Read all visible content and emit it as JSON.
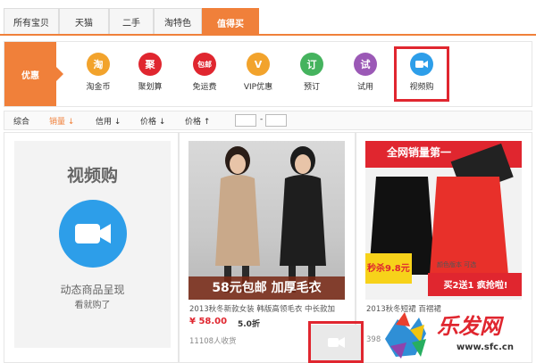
{
  "tabs": [
    "所有宝贝",
    "天猫",
    "二手",
    "淘特色",
    "值得买"
  ],
  "promo_label": "优惠",
  "categories": [
    {
      "label": "淘金币",
      "glyph": "淘",
      "color": "#f2a32c"
    },
    {
      "label": "聚划算",
      "glyph": "聚",
      "color": "#e0262f"
    },
    {
      "label": "免运费",
      "glyph": "包邮",
      "color": "#e0262f"
    },
    {
      "label": "VIP优惠",
      "glyph": "V",
      "color": "#f2a32c"
    },
    {
      "label": "预订",
      "glyph": "订",
      "color": "#45b35e"
    },
    {
      "label": "试用",
      "glyph": "试",
      "color": "#9b59b6"
    },
    {
      "label": "视频购",
      "glyph": "▶",
      "color": "#2d9ee9"
    }
  ],
  "sort": {
    "comprehensive": "综合",
    "sales": "销量",
    "credit": "信用",
    "price_asc": "价格",
    "price_desc": "价格",
    "range_sep": "-"
  },
  "promo_box": {
    "title": "视频购",
    "line1": "动态商品呈现",
    "line2": "看就购了"
  },
  "products": [
    {
      "banner": "58元包邮 加厚毛衣",
      "title": "2013秋冬新款女装 韩版高领毛衣 中长款加",
      "price": "¥ 58.00",
      "rating": "5.0折",
      "sold": "11108人收货"
    },
    {
      "banner_top": "全网销量第一",
      "badge_left": "秒杀9.8元",
      "badge_right": "买2送1 疯抢啦!",
      "small": "颜色版本 可选",
      "title": "2013秋冬短裙 百褶裙",
      "sold": "398"
    }
  ],
  "watermark": {
    "logo": "乐发网",
    "url": "www.sfc.cn"
  }
}
